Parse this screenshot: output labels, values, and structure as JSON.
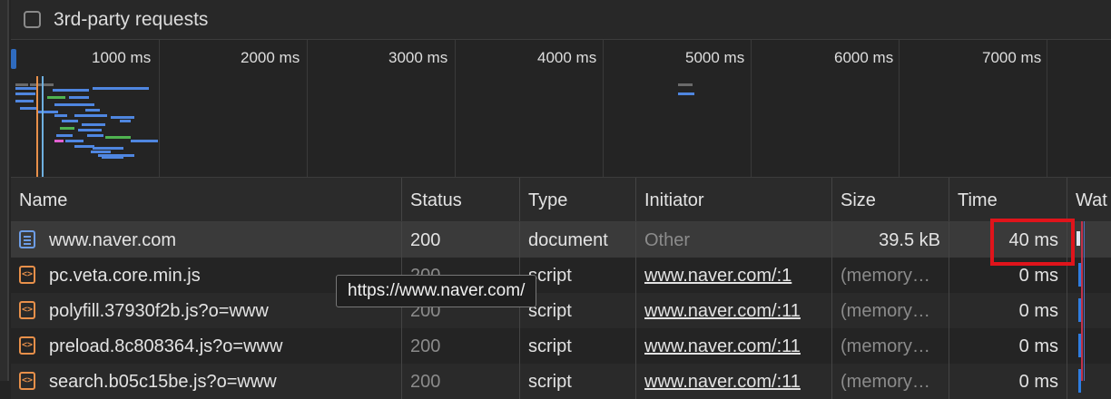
{
  "filter": {
    "third_party_label": "3rd-party requests",
    "checked": false
  },
  "overview": {
    "ticks": [
      "1000 ms",
      "2000 ms",
      "3000 ms",
      "4000 ms",
      "5000 ms",
      "6000 ms",
      "7000 ms"
    ]
  },
  "table": {
    "columns": {
      "name": "Name",
      "status": "Status",
      "type": "Type",
      "initiator": "Initiator",
      "size": "Size",
      "time": "Time",
      "waterfall": "Wat"
    },
    "rows": [
      {
        "icon": "document-icon",
        "name": "www.naver.com",
        "status": "200",
        "type": "document",
        "initiator": "Other",
        "size": "39.5 kB",
        "time": "40 ms"
      },
      {
        "icon": "script-icon",
        "name": "pc.veta.core.min.js",
        "status": "200",
        "type": "script",
        "initiator": "www.naver.com/:1",
        "size": "(memory…",
        "time": "0 ms"
      },
      {
        "icon": "script-icon",
        "name": "polyfill.37930f2b.js?o=www",
        "status": "200",
        "type": "script",
        "initiator": "www.naver.com/:11",
        "size": "(memory…",
        "time": "0 ms"
      },
      {
        "icon": "script-icon",
        "name": "preload.8c808364.js?o=www",
        "status": "200",
        "type": "script",
        "initiator": "www.naver.com/:11",
        "size": "(memory…",
        "time": "0 ms"
      },
      {
        "icon": "script-icon",
        "name": "search.b05c15be.js?o=www",
        "status": "200",
        "type": "script",
        "initiator": "www.naver.com/:11",
        "size": "(memory…",
        "time": "0 ms"
      }
    ]
  },
  "tooltip": {
    "text": "https://www.naver.com/"
  },
  "colors": {
    "highlight": "#e0141b",
    "waterfall_bar": "#2e7de0",
    "accent": "#6d9de6"
  }
}
